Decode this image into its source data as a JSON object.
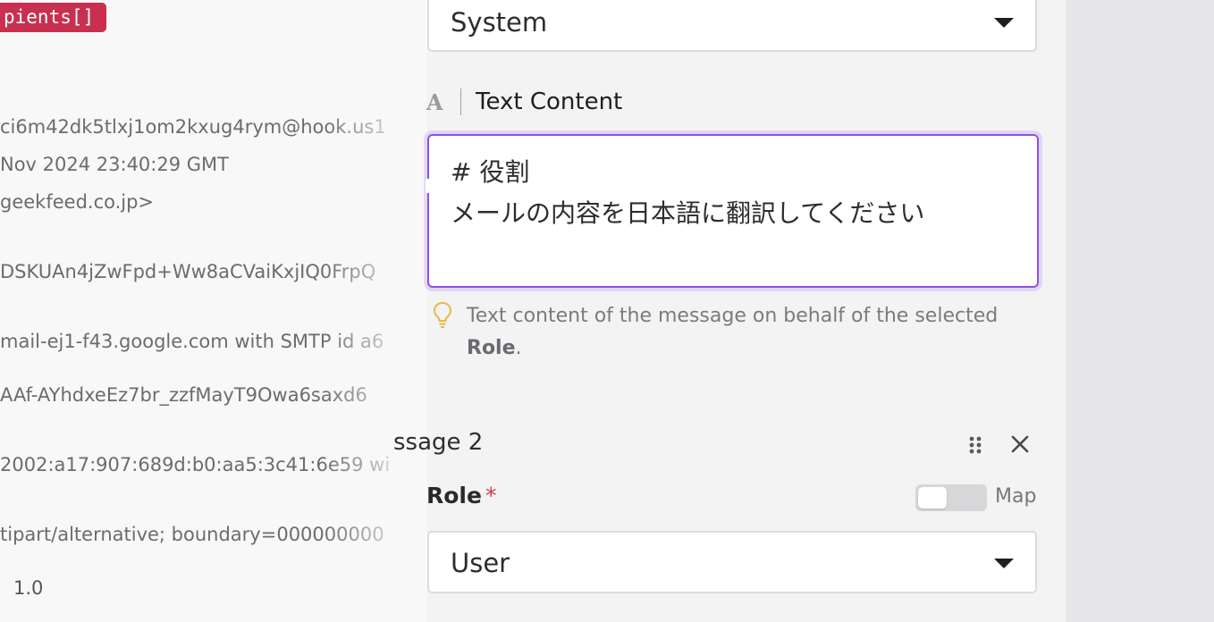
{
  "left_panel": {
    "badge": "pients[]",
    "rows": [
      "ci6m42dk5tlxj1om2kxug4rym@hook.us1",
      "Nov 2024 23:40:29 GMT",
      "geekfeed.co.jp>",
      "DSKUAn4jZwFpd+Ww8aCVaiKxjIQ0FrpQ",
      "mail-ej1-f43.google.com with SMTP id a6",
      "AAf-AYhdxeEz7br_zzfMayT9Owa6saxd6",
      "2002:a17:907:689d:b0:aa5:3c41:6e59 wi",
      "tipart/alternative; boundary=000000000"
    ],
    "version": "1.0"
  },
  "form": {
    "role_select_1": {
      "value": "System"
    },
    "text_content": {
      "type_icon": "A",
      "label": "Text Content",
      "lines": [
        "# 役割",
        "メールの内容を日本語に翻訳してください"
      ],
      "hint_text": "Text content of the message on behalf of the selected",
      "hint_bold": "Role",
      "hint_suffix": "."
    },
    "message_2": {
      "title": "ssage 2",
      "role_label": "Role",
      "required_mark": "*",
      "map_label": "Map",
      "map_toggle_on": false,
      "role_select_value": "User"
    }
  },
  "colors": {
    "badge": "#c9304f",
    "focus_border": "#8f4fe6",
    "required": "#d3384f",
    "hint_icon": "#e8b84a"
  },
  "icons": {
    "hint": "lightbulb-icon",
    "drag": "drag-handle-icon",
    "close": "close-icon",
    "caret": "caret-down-icon",
    "type": "text-type-icon"
  }
}
